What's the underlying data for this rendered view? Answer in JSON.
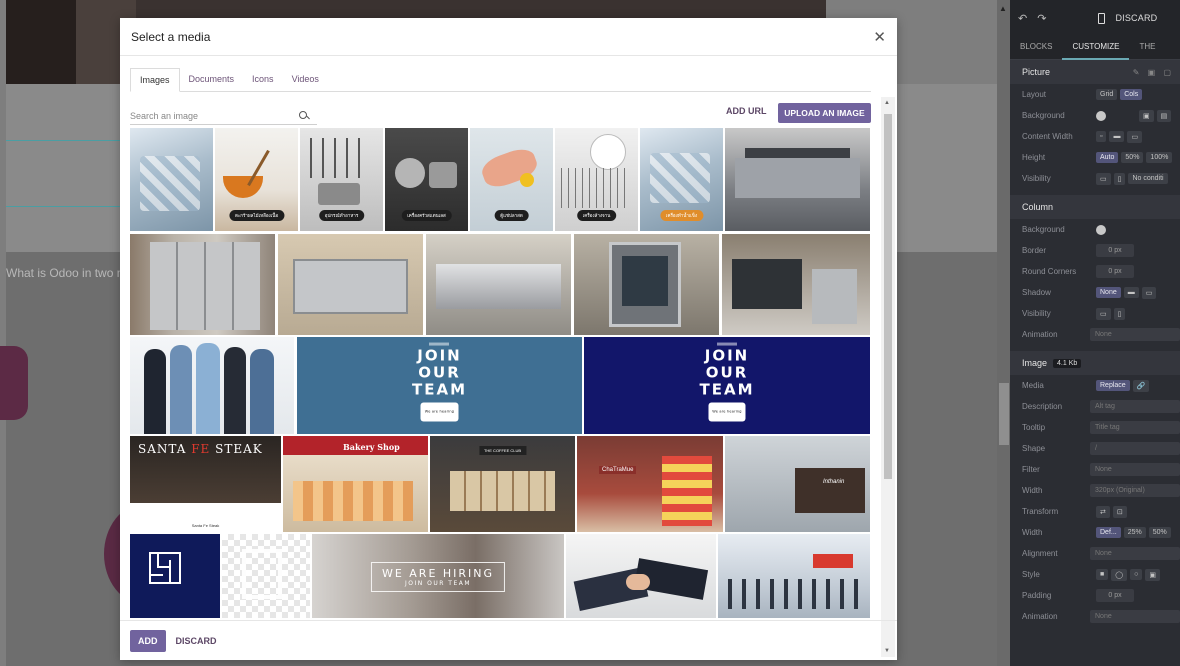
{
  "background": {
    "question_text": "What is Odoo in two m"
  },
  "panel": {
    "discard_label": "DISCARD",
    "tabs": [
      "BLOCKS",
      "CUSTOMIZE",
      "THE"
    ],
    "picture": {
      "title": "Picture",
      "rows": [
        {
          "label": "Layout",
          "values": [
            "Grid",
            "Cols"
          ]
        },
        {
          "label": "Background",
          "values": []
        },
        {
          "label": "Content Width",
          "values": []
        },
        {
          "label": "Height",
          "values": [
            "Auto",
            "50%",
            "100%"
          ]
        },
        {
          "label": "Visibility",
          "values": [
            "No conditi"
          ]
        }
      ]
    },
    "column": {
      "title": "Column",
      "rows": [
        {
          "label": "Background",
          "values": []
        },
        {
          "label": "Border",
          "values": [
            "0 px"
          ]
        },
        {
          "label": "Round Corners",
          "values": [
            "0 px"
          ]
        },
        {
          "label": "Shadow",
          "values": [
            "None"
          ]
        },
        {
          "label": "Visibility",
          "values": []
        },
        {
          "label": "Animation",
          "values": [
            "None"
          ]
        }
      ]
    },
    "image": {
      "title": "Image",
      "size": "4.1 Kb",
      "rows": [
        {
          "label": "Media",
          "values": [
            "Replace"
          ]
        },
        {
          "label": "Description",
          "values": [
            "Alt tag"
          ]
        },
        {
          "label": "Tooltip",
          "values": [
            "Title tag"
          ]
        },
        {
          "label": "Shape",
          "values": [
            "/"
          ]
        },
        {
          "label": "Filter",
          "values": [
            "None"
          ]
        },
        {
          "label": "Width",
          "values": [
            "320px (Original)"
          ]
        },
        {
          "label": "Transform",
          "values": []
        },
        {
          "label": "Width",
          "values": [
            "Def...",
            "25%",
            "50%"
          ]
        },
        {
          "label": "Alignment",
          "values": [
            "None"
          ]
        },
        {
          "label": "Style",
          "values": []
        },
        {
          "label": "Padding",
          "values": [
            "0 px"
          ]
        },
        {
          "label": "Animation",
          "values": [
            "None"
          ]
        }
      ]
    }
  },
  "modal": {
    "title": "Select a media",
    "tabs": [
      "Images",
      "Documents",
      "Icons",
      "Videos"
    ],
    "active_tab": "Images",
    "search_placeholder": "Search an image",
    "add_url_label": "ADD URL",
    "upload_label": "UPLOAD AN IMAGE",
    "footer": {
      "add_label": "ADD",
      "discard_label": "DISCARD"
    },
    "images": {
      "row1_captions": [
        "ตะกร้าผลไม้เหลืองเนื้อ",
        "อุปกรณ์ทำอาหาร",
        "เครื่องครัวสแตนเลส",
        "ตู้แช่ปลาสด",
        "เครื่องล้างจาน",
        "เครื่องทำน้ำแข็ง"
      ],
      "join_title_1": "JOIN",
      "join_title_2": "OUR",
      "join_title_3": "TEAM",
      "join_footer": "We are hearing",
      "santa_text_1": "SANTA ",
      "santa_text_red": "FE",
      "santa_text_2": " STEAK",
      "santa_sub": "Santa Fe Steak",
      "bakery_text": "Bakery Shop",
      "coffee_text": "THE COFFEE CLUB",
      "cha_text": "ChaTraMue",
      "inth_text": "Inthanin",
      "hiring_a": "WE ARE HIRING",
      "hiring_b": "JOIN OUR TEAM"
    }
  }
}
